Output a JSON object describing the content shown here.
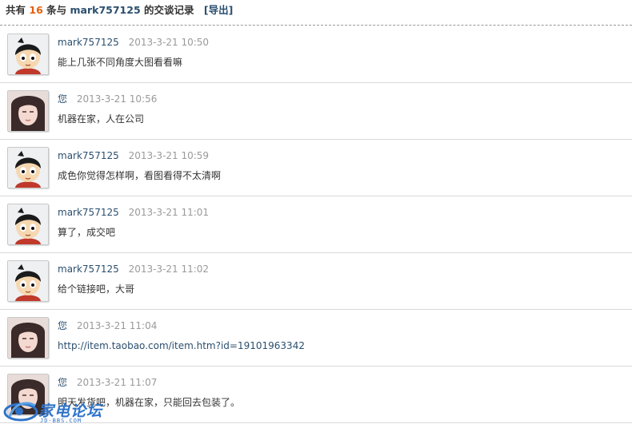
{
  "header": {
    "prefix": "共有",
    "count": "16",
    "middle": "条与",
    "user": "mark757125",
    "suffix": "的交谈记录",
    "export_label": "[导出]"
  },
  "messages": [
    {
      "sender": "mark757125",
      "avatar": "cartoon-avatar",
      "time": "2013-3-21 10:50",
      "text": "能上几张不同角度大图看看嘛"
    },
    {
      "sender": "您",
      "avatar": "girl-avatar",
      "time": "2013-3-21 10:56",
      "text": "机器在家，人在公司"
    },
    {
      "sender": "mark757125",
      "avatar": "cartoon-avatar",
      "time": "2013-3-21 10:59",
      "text": "成色你觉得怎样啊，看图看得不太清啊"
    },
    {
      "sender": "mark757125",
      "avatar": "cartoon-avatar",
      "time": "2013-3-21 11:01",
      "text": "算了，成交吧"
    },
    {
      "sender": "mark757125",
      "avatar": "cartoon-avatar",
      "time": "2013-3-21 11:02",
      "text": "给个链接吧，大哥"
    },
    {
      "sender": "您",
      "avatar": "girl-avatar",
      "time": "2013-3-21 11:04",
      "text": "http://item.taobao.com/item.htm?id=19101963342",
      "is_link": true
    },
    {
      "sender": "您",
      "avatar": "girl-avatar",
      "time": "2013-3-21 11:07",
      "text": "明天发货吧，机器在家，只能回去包装了。"
    }
  ],
  "watermark": {
    "title": "家电论坛",
    "subtitle": "JD-BBS.COM"
  },
  "colors": {
    "count": "#e55f0c",
    "name": "#2b4f6e",
    "time": "#9a9a9a",
    "watermark": "#2e73c8"
  }
}
